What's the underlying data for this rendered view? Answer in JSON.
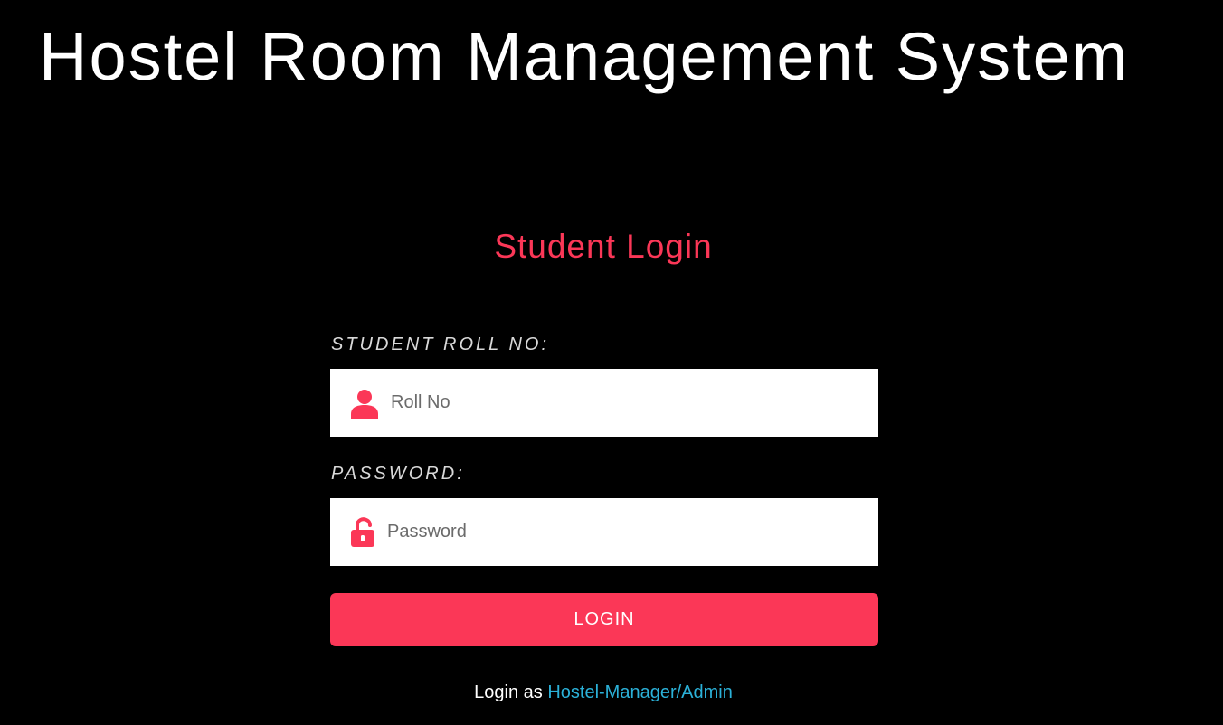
{
  "header": {
    "title": "Hostel Room Management System"
  },
  "login_form": {
    "heading": "Student Login",
    "roll_label": "STUDENT ROLL NO:",
    "roll_placeholder": "Roll No",
    "roll_value": "",
    "roll_icon": "user-icon",
    "password_label": "PASSWORD:",
    "password_placeholder": "Password",
    "password_value": "",
    "password_icon": "unlock-icon",
    "submit_label": "LOGIN"
  },
  "footer": {
    "prefix": "Login as",
    "link_label": "Hostel-Manager/Admin"
  },
  "colors": {
    "background": "#000000",
    "accent": "#fb3757",
    "link": "#2bb1d8",
    "title": "#ffffff",
    "label": "#d9d9d9"
  }
}
